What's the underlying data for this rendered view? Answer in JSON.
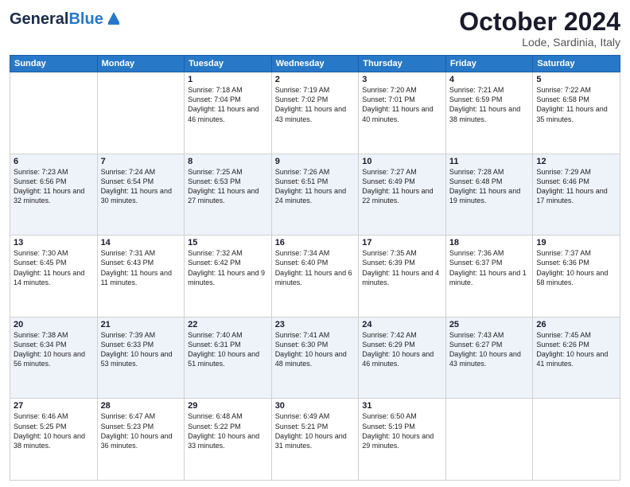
{
  "header": {
    "logo_general": "General",
    "logo_blue": "Blue",
    "month_title": "October 2024",
    "location": "Lode, Sardinia, Italy"
  },
  "days_of_week": [
    "Sunday",
    "Monday",
    "Tuesday",
    "Wednesday",
    "Thursday",
    "Friday",
    "Saturday"
  ],
  "weeks": [
    [
      {
        "day": "",
        "info": ""
      },
      {
        "day": "",
        "info": ""
      },
      {
        "day": "1",
        "info": "Sunrise: 7:18 AM\nSunset: 7:04 PM\nDaylight: 11 hours and 46 minutes."
      },
      {
        "day": "2",
        "info": "Sunrise: 7:19 AM\nSunset: 7:02 PM\nDaylight: 11 hours and 43 minutes."
      },
      {
        "day": "3",
        "info": "Sunrise: 7:20 AM\nSunset: 7:01 PM\nDaylight: 11 hours and 40 minutes."
      },
      {
        "day": "4",
        "info": "Sunrise: 7:21 AM\nSunset: 6:59 PM\nDaylight: 11 hours and 38 minutes."
      },
      {
        "day": "5",
        "info": "Sunrise: 7:22 AM\nSunset: 6:58 PM\nDaylight: 11 hours and 35 minutes."
      }
    ],
    [
      {
        "day": "6",
        "info": "Sunrise: 7:23 AM\nSunset: 6:56 PM\nDaylight: 11 hours and 32 minutes."
      },
      {
        "day": "7",
        "info": "Sunrise: 7:24 AM\nSunset: 6:54 PM\nDaylight: 11 hours and 30 minutes."
      },
      {
        "day": "8",
        "info": "Sunrise: 7:25 AM\nSunset: 6:53 PM\nDaylight: 11 hours and 27 minutes."
      },
      {
        "day": "9",
        "info": "Sunrise: 7:26 AM\nSunset: 6:51 PM\nDaylight: 11 hours and 24 minutes."
      },
      {
        "day": "10",
        "info": "Sunrise: 7:27 AM\nSunset: 6:49 PM\nDaylight: 11 hours and 22 minutes."
      },
      {
        "day": "11",
        "info": "Sunrise: 7:28 AM\nSunset: 6:48 PM\nDaylight: 11 hours and 19 minutes."
      },
      {
        "day": "12",
        "info": "Sunrise: 7:29 AM\nSunset: 6:46 PM\nDaylight: 11 hours and 17 minutes."
      }
    ],
    [
      {
        "day": "13",
        "info": "Sunrise: 7:30 AM\nSunset: 6:45 PM\nDaylight: 11 hours and 14 minutes."
      },
      {
        "day": "14",
        "info": "Sunrise: 7:31 AM\nSunset: 6:43 PM\nDaylight: 11 hours and 11 minutes."
      },
      {
        "day": "15",
        "info": "Sunrise: 7:32 AM\nSunset: 6:42 PM\nDaylight: 11 hours and 9 minutes."
      },
      {
        "day": "16",
        "info": "Sunrise: 7:34 AM\nSunset: 6:40 PM\nDaylight: 11 hours and 6 minutes."
      },
      {
        "day": "17",
        "info": "Sunrise: 7:35 AM\nSunset: 6:39 PM\nDaylight: 11 hours and 4 minutes."
      },
      {
        "day": "18",
        "info": "Sunrise: 7:36 AM\nSunset: 6:37 PM\nDaylight: 11 hours and 1 minute."
      },
      {
        "day": "19",
        "info": "Sunrise: 7:37 AM\nSunset: 6:36 PM\nDaylight: 10 hours and 58 minutes."
      }
    ],
    [
      {
        "day": "20",
        "info": "Sunrise: 7:38 AM\nSunset: 6:34 PM\nDaylight: 10 hours and 56 minutes."
      },
      {
        "day": "21",
        "info": "Sunrise: 7:39 AM\nSunset: 6:33 PM\nDaylight: 10 hours and 53 minutes."
      },
      {
        "day": "22",
        "info": "Sunrise: 7:40 AM\nSunset: 6:31 PM\nDaylight: 10 hours and 51 minutes."
      },
      {
        "day": "23",
        "info": "Sunrise: 7:41 AM\nSunset: 6:30 PM\nDaylight: 10 hours and 48 minutes."
      },
      {
        "day": "24",
        "info": "Sunrise: 7:42 AM\nSunset: 6:29 PM\nDaylight: 10 hours and 46 minutes."
      },
      {
        "day": "25",
        "info": "Sunrise: 7:43 AM\nSunset: 6:27 PM\nDaylight: 10 hours and 43 minutes."
      },
      {
        "day": "26",
        "info": "Sunrise: 7:45 AM\nSunset: 6:26 PM\nDaylight: 10 hours and 41 minutes."
      }
    ],
    [
      {
        "day": "27",
        "info": "Sunrise: 6:46 AM\nSunset: 5:25 PM\nDaylight: 10 hours and 38 minutes."
      },
      {
        "day": "28",
        "info": "Sunrise: 6:47 AM\nSunset: 5:23 PM\nDaylight: 10 hours and 36 minutes."
      },
      {
        "day": "29",
        "info": "Sunrise: 6:48 AM\nSunset: 5:22 PM\nDaylight: 10 hours and 33 minutes."
      },
      {
        "day": "30",
        "info": "Sunrise: 6:49 AM\nSunset: 5:21 PM\nDaylight: 10 hours and 31 minutes."
      },
      {
        "day": "31",
        "info": "Sunrise: 6:50 AM\nSunset: 5:19 PM\nDaylight: 10 hours and 29 minutes."
      },
      {
        "day": "",
        "info": ""
      },
      {
        "day": "",
        "info": ""
      }
    ]
  ]
}
